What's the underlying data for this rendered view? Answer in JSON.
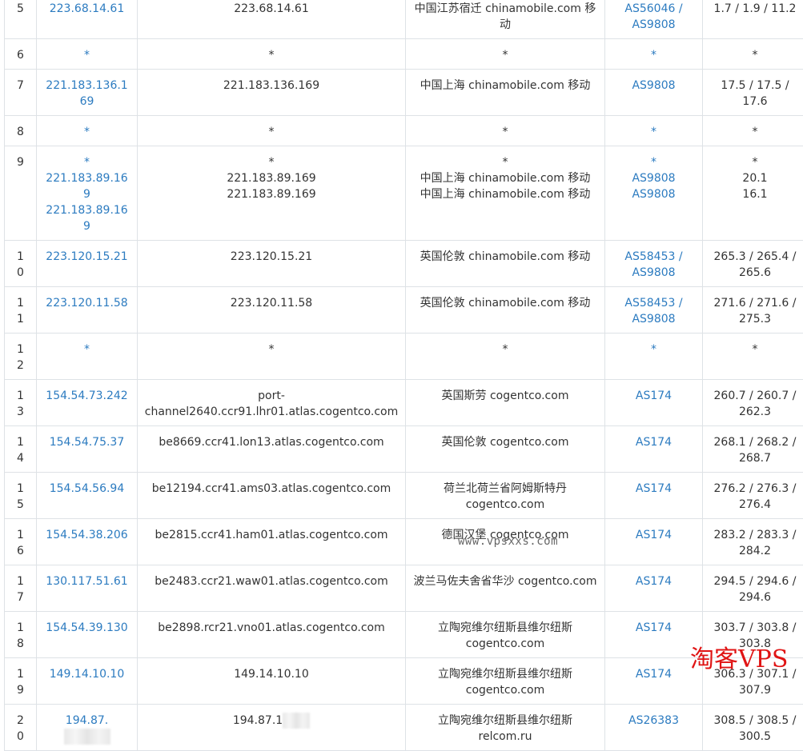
{
  "rows": [
    {
      "hop": "5",
      "ip": [
        "223.68.14.61"
      ],
      "ptr": [
        "223.68.14.61"
      ],
      "geo": [
        "中国江苏宿迁 chinamobile.com 移动"
      ],
      "asn": [
        "AS56046 / AS9808"
      ],
      "rtt": [
        "1.7 / 1.9 / 11.2"
      ]
    },
    {
      "hop": "6",
      "ip": [
        "*"
      ],
      "ptr": [
        "*"
      ],
      "geo": [
        "*"
      ],
      "asn": [
        "*"
      ],
      "rtt": [
        "*"
      ]
    },
    {
      "hop": "7",
      "ip": [
        "221.183.136.169"
      ],
      "ptr": [
        "221.183.136.169"
      ],
      "geo": [
        "中国上海 chinamobile.com 移动"
      ],
      "asn": [
        "AS9808"
      ],
      "rtt": [
        "17.5 / 17.5 / 17.6"
      ]
    },
    {
      "hop": "8",
      "ip": [
        "*"
      ],
      "ptr": [
        "*"
      ],
      "geo": [
        "*"
      ],
      "asn": [
        "*"
      ],
      "rtt": [
        "*"
      ]
    },
    {
      "hop": "9",
      "ip": [
        "*",
        "221.183.89.169",
        "221.183.89.169"
      ],
      "ptr": [
        "*",
        "221.183.89.169",
        "221.183.89.169"
      ],
      "geo": [
        "*",
        "中国上海 chinamobile.com 移动",
        "中国上海 chinamobile.com 移动"
      ],
      "asn": [
        "*",
        "AS9808",
        "AS9808"
      ],
      "rtt": [
        "*",
        "20.1",
        "16.1"
      ]
    },
    {
      "hop": "10",
      "ip": [
        "223.120.15.21"
      ],
      "ptr": [
        "223.120.15.21"
      ],
      "geo": [
        "英国伦敦 chinamobile.com 移动"
      ],
      "asn": [
        "AS58453 / AS9808"
      ],
      "rtt": [
        "265.3 / 265.4 / 265.6"
      ]
    },
    {
      "hop": "11",
      "ip": [
        "223.120.11.58"
      ],
      "ptr": [
        "223.120.11.58"
      ],
      "geo": [
        "英国伦敦 chinamobile.com 移动"
      ],
      "asn": [
        "AS58453 / AS9808"
      ],
      "rtt": [
        "271.6 / 271.6 / 275.3"
      ]
    },
    {
      "hop": "12",
      "ip": [
        "*"
      ],
      "ptr": [
        "*"
      ],
      "geo": [
        "*"
      ],
      "asn": [
        "*"
      ],
      "rtt": [
        "*"
      ]
    },
    {
      "hop": "13",
      "ip": [
        "154.54.73.242"
      ],
      "ptr": [
        "port-channel2640.ccr91.lhr01.atlas.cogentco.com"
      ],
      "geo": [
        "英国斯劳 cogentco.com"
      ],
      "asn": [
        "AS174"
      ],
      "rtt": [
        "260.7 / 260.7 / 262.3"
      ]
    },
    {
      "hop": "14",
      "ip": [
        "154.54.75.37"
      ],
      "ptr": [
        "be8669.ccr41.lon13.atlas.cogentco.com"
      ],
      "geo": [
        "英国伦敦 cogentco.com"
      ],
      "asn": [
        "AS174"
      ],
      "rtt": [
        "268.1 / 268.2 / 268.7"
      ]
    },
    {
      "hop": "15",
      "ip": [
        "154.54.56.94"
      ],
      "ptr": [
        "be12194.ccr41.ams03.atlas.cogentco.com"
      ],
      "geo": [
        "荷兰北荷兰省阿姆斯特丹 cogentco.com"
      ],
      "asn": [
        "AS174"
      ],
      "rtt": [
        "276.2 / 276.3 / 276.4"
      ]
    },
    {
      "hop": "16",
      "ip": [
        "154.54.38.206"
      ],
      "ptr": [
        "be2815.ccr41.ham01.atlas.cogentco.com"
      ],
      "geo": [
        "德国汉堡 cogentco.com"
      ],
      "asn": [
        "AS174"
      ],
      "rtt": [
        "283.2 / 283.3 / 284.2"
      ]
    },
    {
      "hop": "17",
      "ip": [
        "130.117.51.61"
      ],
      "ptr": [
        "be2483.ccr21.waw01.atlas.cogentco.com"
      ],
      "geo": [
        "波兰马佐夫舍省华沙 cogentco.com"
      ],
      "asn": [
        "AS174"
      ],
      "rtt": [
        "294.5 / 294.6 / 294.6"
      ]
    },
    {
      "hop": "18",
      "ip": [
        "154.54.39.130"
      ],
      "ptr": [
        "be2898.rcr21.vno01.atlas.cogentco.com"
      ],
      "geo": [
        "立陶宛维尔纽斯县维尔纽斯 cogentco.com"
      ],
      "asn": [
        "AS174"
      ],
      "rtt": [
        "303.7 / 303.8 / 303.8"
      ]
    },
    {
      "hop": "19",
      "ip": [
        "149.14.10.10"
      ],
      "ptr": [
        "149.14.10.10"
      ],
      "geo": [
        "立陶宛维尔纽斯县维尔纽斯 cogentco.com"
      ],
      "asn": [
        "AS174"
      ],
      "rtt": [
        "306.3 / 307.1 / 307.9"
      ]
    },
    {
      "hop": "20",
      "ip": [
        "194.87."
      ],
      "ptr": [
        "194.87.1"
      ],
      "geo": [
        "立陶宛维尔纽斯县维尔纽斯 relcom.ru"
      ],
      "asn": [
        "AS26383"
      ],
      "rtt": [
        "308.5 / 308.5 / 300.5"
      ],
      "redacted": true
    }
  ],
  "watermarks": {
    "center": "www.vpsxxs.com",
    "corner": "淘客VPS"
  },
  "colors": {
    "link": "#2c7bc0",
    "text": "#333333",
    "border": "#dee2e6",
    "watermark_corner": "#e01414"
  }
}
